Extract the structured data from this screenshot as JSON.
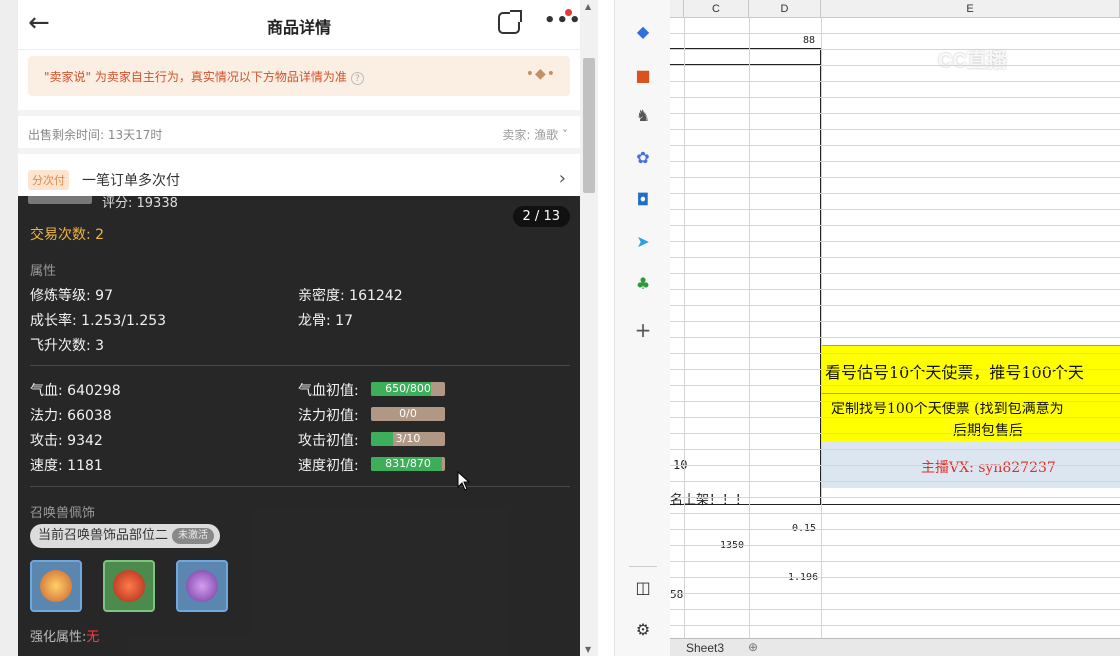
{
  "header": {
    "title": "商品详情",
    "back_icon": "←"
  },
  "notice": {
    "text": "\"卖家说\" 为卖家自主行为，真实情况以下方物品详情为准",
    "help_icon": "?"
  },
  "info": {
    "remaining": "出售剩余时间: 13天17时",
    "seller": "卖家: 渔歌 ˅"
  },
  "payment": {
    "tag": "分次付",
    "label": "一笔订单多次付"
  },
  "card": {
    "score": "评分: 19338",
    "pager": "2 / 13",
    "trade_count": "交易次数: 2",
    "section_attr": "属性",
    "cultivation": "修炼等级: 97",
    "intimacy": "亲密度: 161242",
    "growth": "成长率: 1.253/1.253",
    "dragon_bone": "龙骨: 17",
    "ascend": "飞升次数: 3",
    "hp": "气血: 640298",
    "mp": "法力: 66038",
    "atk": "攻击: 9342",
    "speed": "速度: 1181",
    "hp_init_label": "气血初值:",
    "mp_init_label": "法力初值:",
    "atk_init_label": "攻击初值:",
    "speed_init_label": "速度初值:",
    "hp_init": {
      "text": "650/800",
      "fraction": 0.8125
    },
    "mp_init": {
      "text": "0/0",
      "fraction": 0
    },
    "atk_init": {
      "text": "3/10",
      "fraction": 0.3
    },
    "speed_init": {
      "text": "831/870",
      "fraction": 0.955
    },
    "section_acc": "召唤兽佩饰",
    "acc_label": "当前召唤兽饰品部位二",
    "acc_badge": "未激活",
    "enhance_label": "强化属性:",
    "enhance_value": "无"
  },
  "sheet": {
    "col_c": "C",
    "col_d": "D",
    "col_e": "E",
    "d_88": "88",
    "yellow1": "看号估号10个天使票，推号100个天",
    "yellow2a": "定制找号100个天使票 (找到包满意为",
    "yellow2b": "后期包售后",
    "blue": "主播VX: syn827237",
    "leftnum": "10",
    "listing": "名上架！！！",
    "d_015": "0.15",
    "c_1350": "1350",
    "d_1196": "1.196",
    "left58": "58",
    "tab": "Sheet3",
    "watermark": "CC直播"
  }
}
